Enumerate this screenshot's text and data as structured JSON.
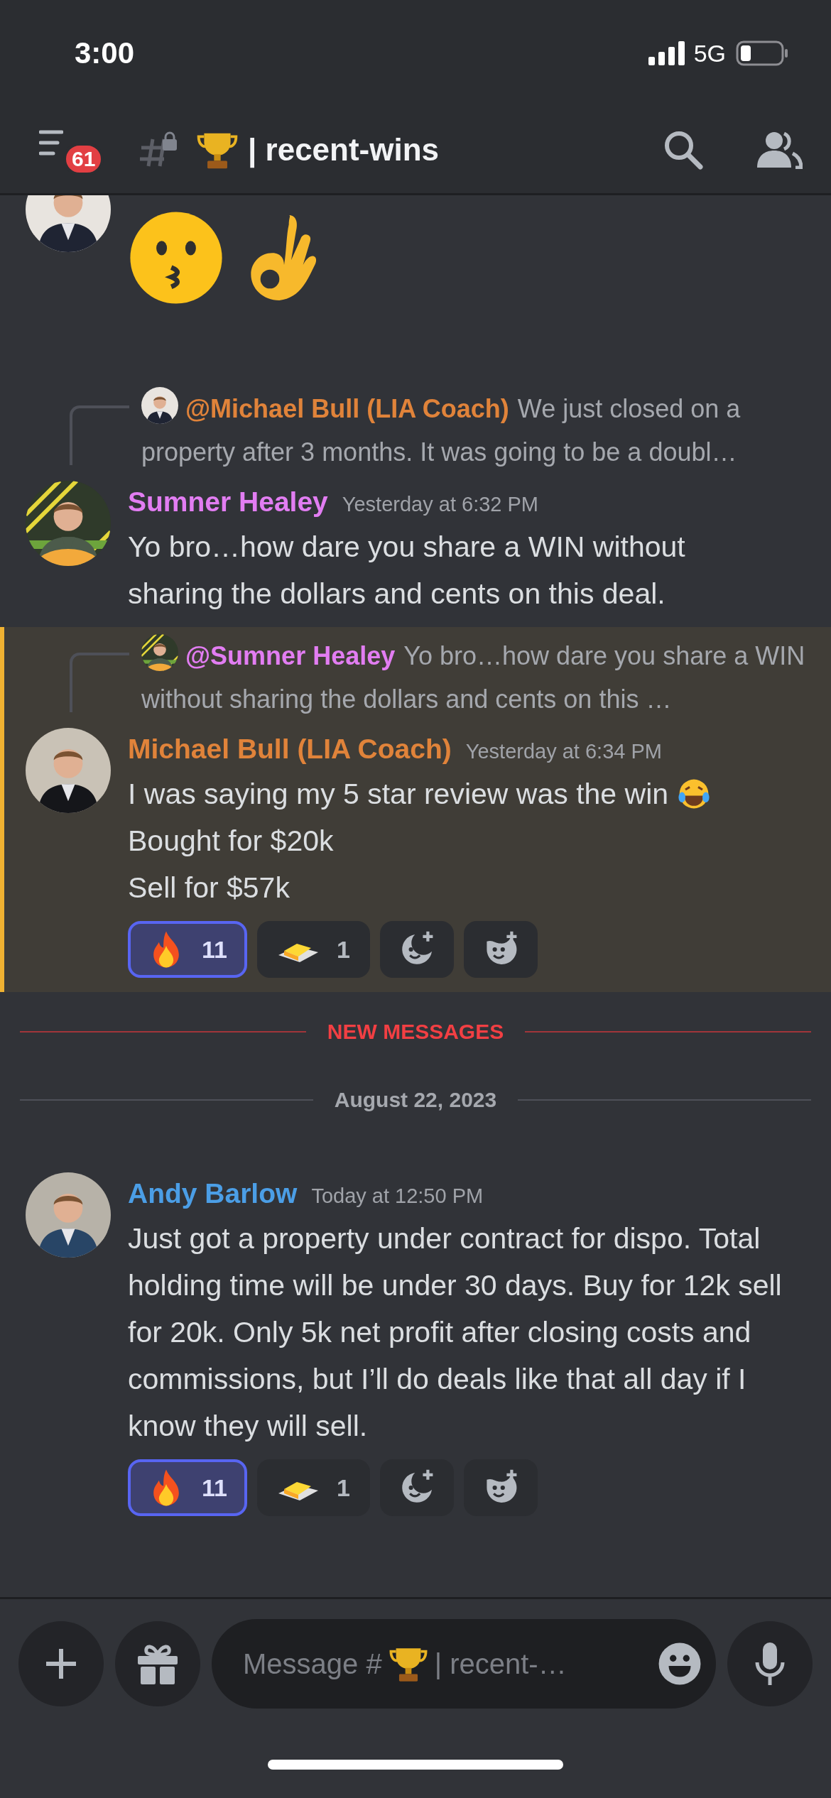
{
  "status_bar": {
    "time": "3:00",
    "network": "5G"
  },
  "header": {
    "badge": "61",
    "channel": "| recent-wins"
  },
  "feed": [
    {
      "kind": "continuation",
      "highlighted": false
    },
    {
      "kind": "message",
      "highlighted": false,
      "reply_to": {
        "mention": "@Michael Bull (LIA Coach)",
        "color": "#e0833a",
        "text": "We just closed on a property after 3 months. It was going to be a doubl…"
      },
      "author": "Sumner Healey",
      "color": "#e27df2",
      "time": "Yesterday at 6:32 PM",
      "lines": [
        {
          "text": "Yo bro…how dare you share a WIN without sharing the dollars and cents on this deal.",
          "has_emoji": false
        }
      ]
    },
    {
      "kind": "message",
      "highlighted": true,
      "reply_to": {
        "mention": "@Sumner Healey",
        "color": "#e27df2",
        "text": "Yo bro…how dare you share a WIN without sharing the dollars and cents on this …"
      },
      "author": "Michael Bull (LIA Coach)",
      "color": "#e0833a",
      "time": "Yesterday at 6:34 PM",
      "lines": [
        {
          "text": "I was saying my 5 star review was the win",
          "has_emoji": true
        },
        {
          "text": "Bought for $20k",
          "has_emoji": false
        },
        {
          "text": "Sell for $57k",
          "has_emoji": false
        }
      ],
      "reactions": [
        {
          "kind": "reaction",
          "count": "11",
          "selected": true
        },
        {
          "kind": "reaction",
          "count": "1",
          "selected": false
        },
        {
          "kind": "add"
        },
        {
          "kind": "add_super"
        }
      ]
    },
    {
      "kind": "new_marker",
      "label": "NEW MESSAGES"
    },
    {
      "kind": "date",
      "label": "August 22, 2023"
    },
    {
      "kind": "message",
      "highlighted": false,
      "author": "Andy Barlow",
      "color": "#4b9ee6",
      "time": "Today at 12:50 PM",
      "lines": [
        {
          "text": "Just got a property under contract for dispo. Total holding time will be under 30 days.  Buy for 12k sell for 20k. Only 5k net profit after closing costs and commissions, but I’ll do deals like  that all day if I know they will sell.",
          "has_emoji": false
        }
      ],
      "reactions": [
        {
          "kind": "reaction",
          "count": "11",
          "selected": true
        },
        {
          "kind": "reaction",
          "count": "1",
          "selected": false
        },
        {
          "kind": "add"
        },
        {
          "kind": "add_super"
        }
      ]
    }
  ],
  "composer": {
    "hint_start": "Message #",
    "hint_end": "| recent-…"
  }
}
